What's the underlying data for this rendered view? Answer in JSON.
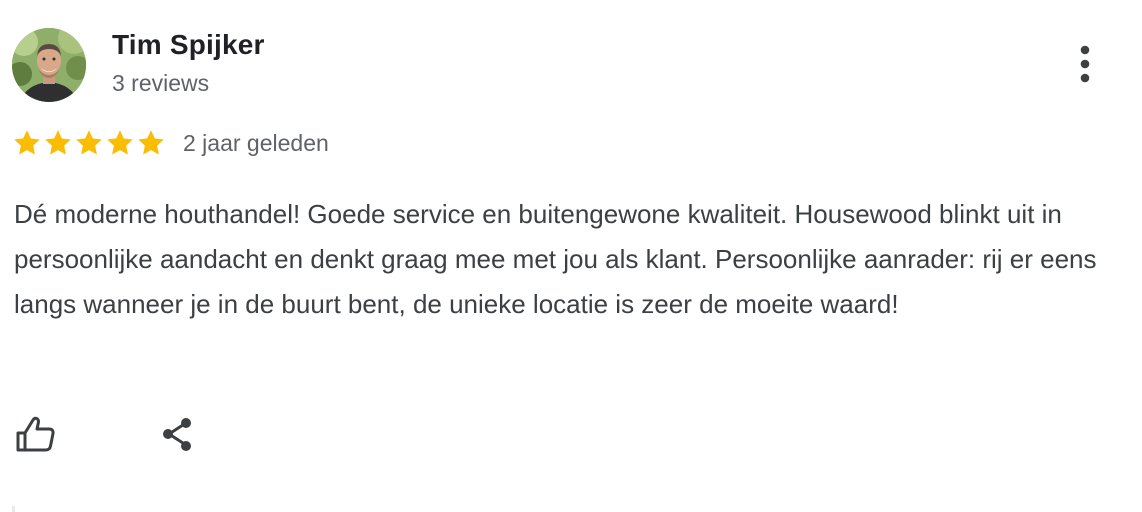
{
  "reviewer": {
    "name": "Tim Spijker",
    "review_count": "3 reviews",
    "avatar_icon": "profile-photo"
  },
  "rating": {
    "stars": 5,
    "max_stars": 5,
    "star_color": "#fbbc04",
    "date": "2 jaar geleden"
  },
  "review": {
    "text": "Dé moderne houthandel! Goede service en buitengewone kwaliteit. Housewood blinkt uit in persoonlijke aandacht en denkt graag mee met jou als klant. Persoonlijke aanrader: rij er eens langs wanneer je in de buurt bent, de unieke locatie is zeer de moeite waard!"
  },
  "actions": {
    "like_icon": "thumbs-up-icon",
    "share_icon": "share-icon",
    "more_icon": "more-vert-icon"
  },
  "colors": {
    "name_text": "#202124",
    "secondary_text": "#5f6368",
    "body_text": "#3c4043",
    "icon": "#3c4043"
  }
}
